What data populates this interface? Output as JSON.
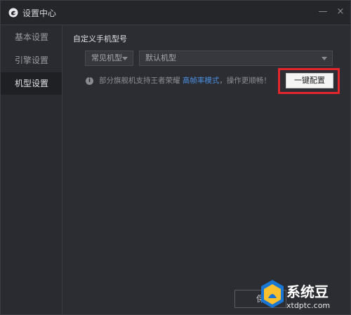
{
  "window": {
    "title": "设置中心",
    "minimize_glyph": "—",
    "close_glyph": "×"
  },
  "sidebar": {
    "items": [
      {
        "label": "基本设置",
        "active": false
      },
      {
        "label": "引擎设置",
        "active": false
      },
      {
        "label": "机型设置",
        "active": true
      }
    ]
  },
  "main": {
    "section_label": "自定义手机型号",
    "type_select": {
      "value": "常见机型"
    },
    "model_select": {
      "value": "默认机型"
    },
    "info": {
      "icon": "info-icon",
      "text_before": "部分旗舰机支持王者荣耀 ",
      "link_text": "高帧率模式",
      "text_after": "，操作更顺畅！"
    },
    "config_button": {
      "label": "一键配置"
    },
    "bottom_button": {
      "label": "保"
    }
  },
  "watermark": {
    "brand": "系统豆",
    "url": "xtdptc.com"
  },
  "colors": {
    "highlight": "#e3262b",
    "link": "#4a90e2",
    "background": "#2c2d32"
  }
}
